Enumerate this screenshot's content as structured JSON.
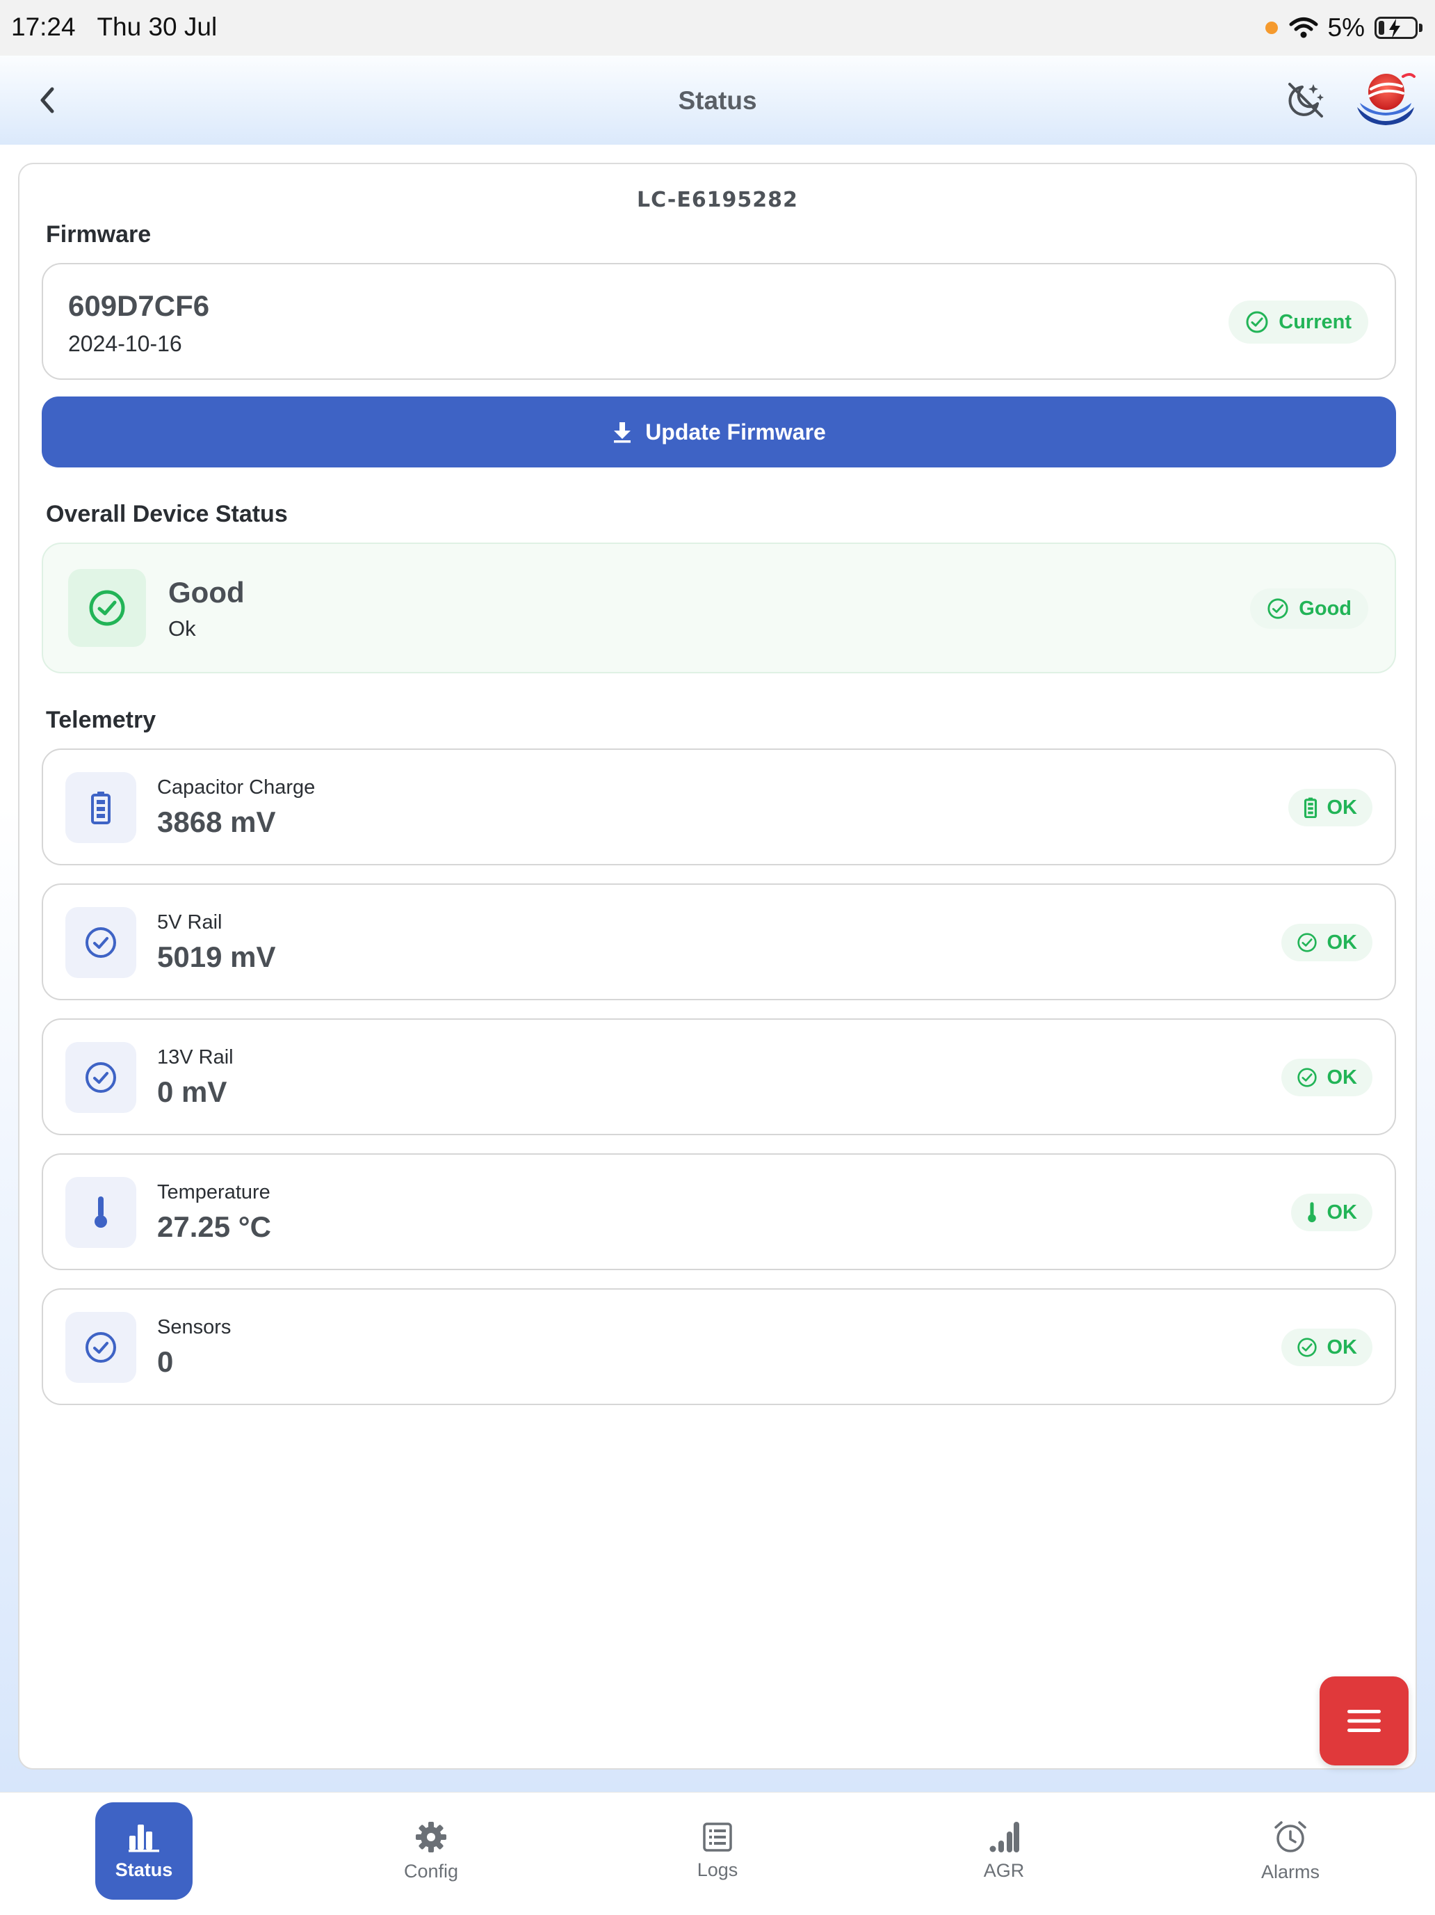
{
  "status_bar": {
    "time": "17:24",
    "date": "Thu 30 Jul",
    "battery": "5%"
  },
  "header": {
    "title": "Status"
  },
  "device": {
    "id": "LC-E6195282"
  },
  "firmware": {
    "section_label": "Firmware",
    "version": "609D7CF6",
    "date": "2024-10-16",
    "badge": "Current",
    "update_button": "Update Firmware"
  },
  "overall": {
    "section_label": "Overall Device Status",
    "title": "Good",
    "subtitle": "Ok",
    "badge": "Good"
  },
  "telemetry": {
    "section_label": "Telemetry",
    "items": [
      {
        "label": "Capacitor Charge",
        "value": "3868 mV",
        "status": "OK",
        "icon": "battery-icon"
      },
      {
        "label": "5V Rail",
        "value": "5019 mV",
        "status": "OK",
        "icon": "check-circle-icon"
      },
      {
        "label": "13V Rail",
        "value": "0 mV",
        "status": "OK",
        "icon": "check-circle-icon"
      },
      {
        "label": "Temperature",
        "value": "27.25 °C",
        "status": "OK",
        "icon": "thermometer-icon"
      },
      {
        "label": "Sensors",
        "value": "0",
        "status": "OK",
        "icon": "check-circle-icon"
      }
    ]
  },
  "tabs": [
    {
      "label": "Status",
      "icon": "bar-chart-icon",
      "active": true
    },
    {
      "label": "Config",
      "icon": "gear-icon",
      "active": false
    },
    {
      "label": "Logs",
      "icon": "list-icon",
      "active": false
    },
    {
      "label": "AGR",
      "icon": "signal-bars-icon",
      "active": false
    },
    {
      "label": "Alarms",
      "icon": "alarm-clock-icon",
      "active": false
    }
  ],
  "colors": {
    "primary": "#3e63c5",
    "success": "#22b457",
    "danger": "#e0393b"
  }
}
